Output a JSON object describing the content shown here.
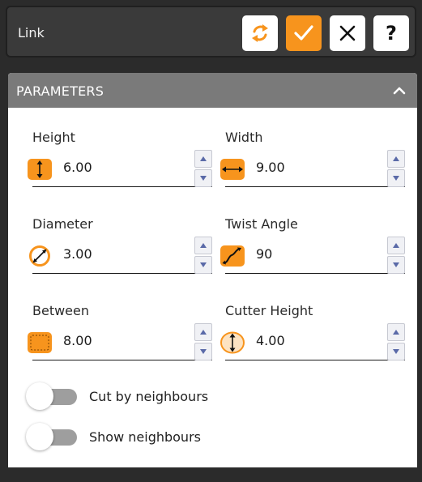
{
  "toolbar": {
    "title": "Link",
    "buttons": {
      "refresh_icon": "refresh-icon",
      "confirm_icon": "check-icon",
      "close_icon": "close-icon",
      "help_label": "?"
    },
    "accent_color": "#f7941d"
  },
  "panel": {
    "title": "PARAMETERS",
    "collapse_icon": "chevron-up-icon"
  },
  "fields": {
    "height": {
      "label": "Height",
      "value": "6.00",
      "icon": "height-icon"
    },
    "width": {
      "label": "Width",
      "value": "9.00",
      "icon": "width-icon"
    },
    "diameter": {
      "label": "Diameter",
      "value": "3.00",
      "icon": "diameter-icon"
    },
    "twist_angle": {
      "label": "Twist Angle",
      "value": "90",
      "icon": "twist-angle-icon"
    },
    "between": {
      "label": "Between",
      "value": "8.00",
      "icon": "between-icon"
    },
    "cutter_height": {
      "label": "Cutter Height",
      "value": "4.00",
      "icon": "cutter-height-icon"
    }
  },
  "toggles": {
    "cut_by_neighbours": {
      "label": "Cut by neighbours",
      "on": false
    },
    "show_neighbours": {
      "label": "Show neighbours",
      "on": false
    }
  }
}
